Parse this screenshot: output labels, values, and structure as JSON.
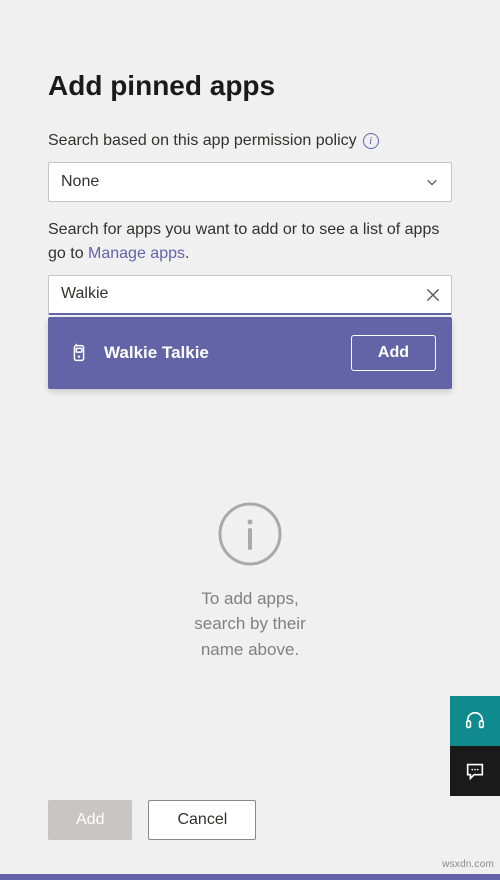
{
  "title": "Add pinned apps",
  "policy": {
    "label": "Search based on this app permission policy",
    "value": "None"
  },
  "search": {
    "help_prefix": "Search for apps you want to add or to see a list of apps go to ",
    "help_link": "Manage apps",
    "help_suffix": ".",
    "value": "Walkie"
  },
  "result": {
    "name": "Walkie Talkie",
    "add_label": "Add"
  },
  "empty": {
    "text": "To add apps,\nsearch by their\nname above."
  },
  "footer": {
    "add": "Add",
    "cancel": "Cancel"
  },
  "watermark": "wsxdn.com"
}
